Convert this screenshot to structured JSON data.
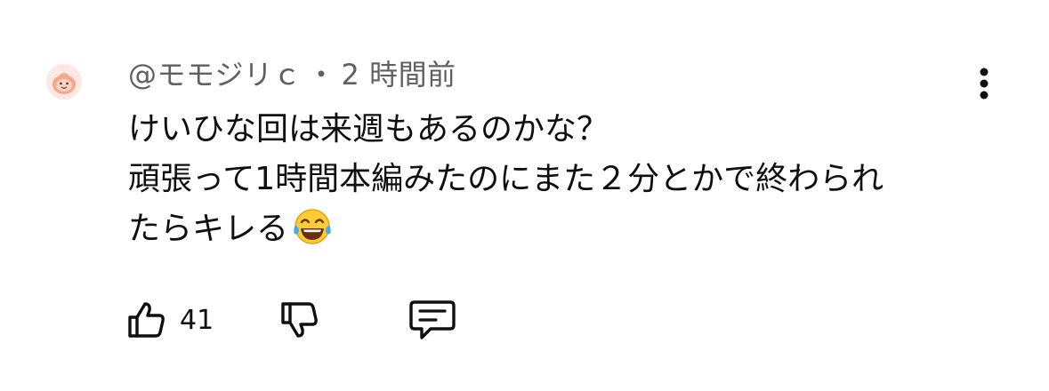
{
  "comment": {
    "author": "@モモジリｃ",
    "separator": "・",
    "timestamp": "2 時間前",
    "text_lines": [
      "けいひな回は来週もあるのかな？",
      "頑張って1時間本編みたのにまた２分とかで終わられ",
      "たらキレる"
    ],
    "trailing_emoji": "face-with-tears-of-joy",
    "likes": "41"
  },
  "icons": {
    "avatar": "pink-character-avatar",
    "menu": "more-vert-icon",
    "like": "thumbs-up-icon",
    "dislike": "thumbs-down-icon",
    "reply": "comment-bubble-icon"
  },
  "colors": {
    "text": "#0f0f0f",
    "meta": "#606060",
    "avatar_bg": "#fde7e2"
  }
}
